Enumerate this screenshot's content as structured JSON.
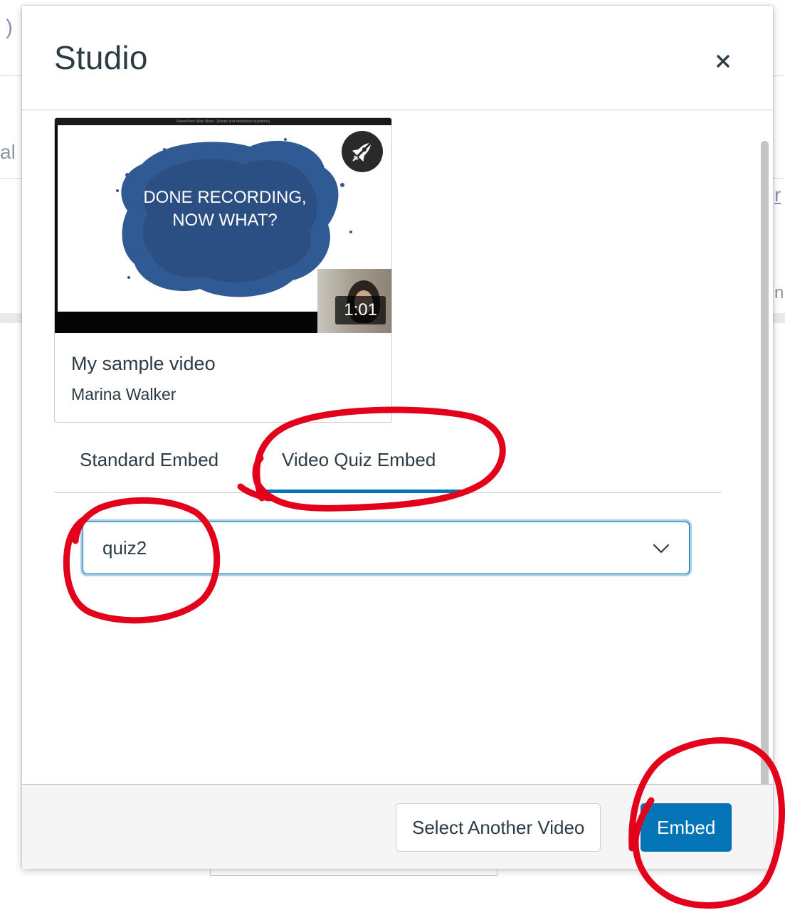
{
  "modal": {
    "title": "Studio",
    "close_label": "×"
  },
  "video": {
    "title": "My sample video",
    "author": "Marina Walker",
    "duration": "1:01",
    "slide_line1": "DONE RECORDING,",
    "slide_line2": "NOW WHAT?",
    "slide_header": "PowerPoint Slide Show - [Studio and embedded questions]"
  },
  "tabs": [
    {
      "label": "Standard Embed",
      "active": false
    },
    {
      "label": "Video Quiz Embed",
      "active": true
    }
  ],
  "quiz_select": {
    "value": "quiz2"
  },
  "footer": {
    "select_another_label": "Select Another Video",
    "embed_label": "Embed"
  },
  "background": {
    "frag_top_left": ")",
    "frag_left": "al",
    "frag_right_link": "r",
    "frag_right": "n"
  },
  "colors": {
    "accent": "#0374b5",
    "annotation": "#e3001b",
    "text": "#2d3b45"
  },
  "icons": [
    "close-icon",
    "rocket-icon",
    "chevron-down-icon"
  ]
}
